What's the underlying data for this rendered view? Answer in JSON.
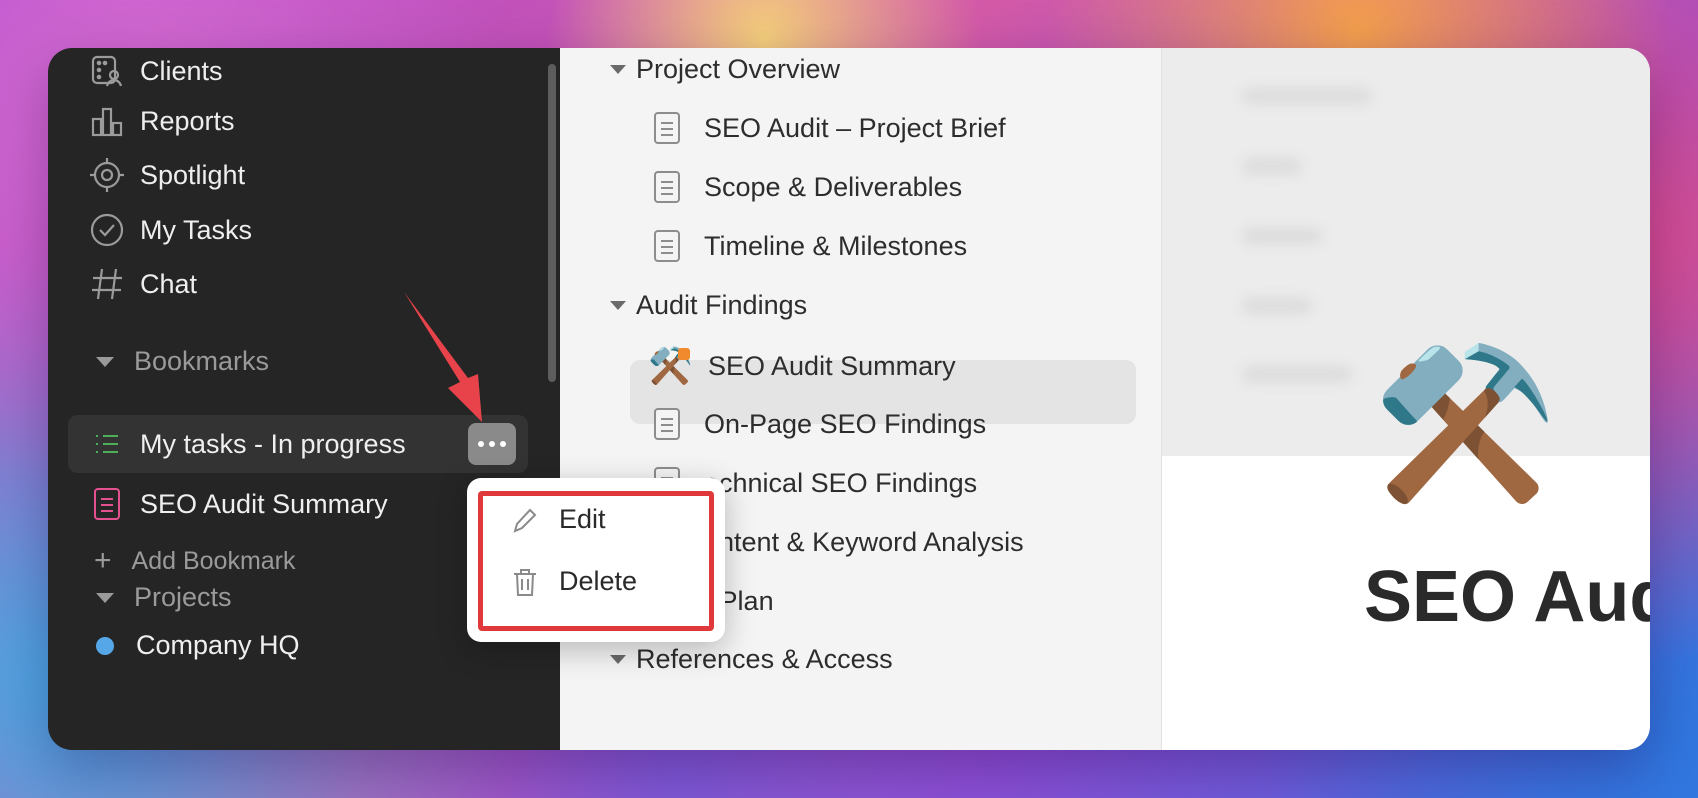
{
  "sidebar": {
    "nav": [
      {
        "label": "Clients",
        "icon": "clients-icon"
      },
      {
        "label": "Reports",
        "icon": "bar-chart-icon"
      },
      {
        "label": "Spotlight",
        "icon": "target-icon"
      },
      {
        "label": "My Tasks",
        "icon": "check-circle-icon"
      },
      {
        "label": "Chat",
        "icon": "hash-icon"
      }
    ],
    "bookmarks_title": "Bookmarks",
    "bookmarks": [
      {
        "label": "My tasks - In progress",
        "icon": "list-icon"
      },
      {
        "label": "SEO Audit Summary",
        "icon": "document-icon"
      }
    ],
    "add_bookmark": "Add Bookmark",
    "projects_title": "Projects",
    "projects": [
      {
        "label": "Company HQ",
        "color": "#55a7e8"
      }
    ]
  },
  "tree": {
    "groups": [
      {
        "label": "Project Overview",
        "expanded": true
      },
      {
        "label": "Audit Findings",
        "expanded": true
      },
      {
        "label": "Action Plan",
        "expanded": false
      },
      {
        "label": "References & Access",
        "expanded": true
      }
    ],
    "docs": [
      "SEO Audit – Project Brief",
      "Scope & Deliverables",
      "Timeline & Milestones",
      "SEO Audit Summary",
      "On-Page SEO Findings",
      "Technical SEO Findings",
      "Content & Keyword Analysis"
    ],
    "visible_docs": [
      "echnical SEO Findings",
      "ontent & Keyword Analysis"
    ]
  },
  "page": {
    "emoji": "⚒️",
    "title": "SEO Aud"
  },
  "context_menu": {
    "items": [
      {
        "label": "Edit",
        "icon": "pencil-icon"
      },
      {
        "label": "Delete",
        "icon": "trash-icon"
      }
    ]
  },
  "colors": {
    "highlight": "#e0393c",
    "arrow": "#e8434a"
  }
}
